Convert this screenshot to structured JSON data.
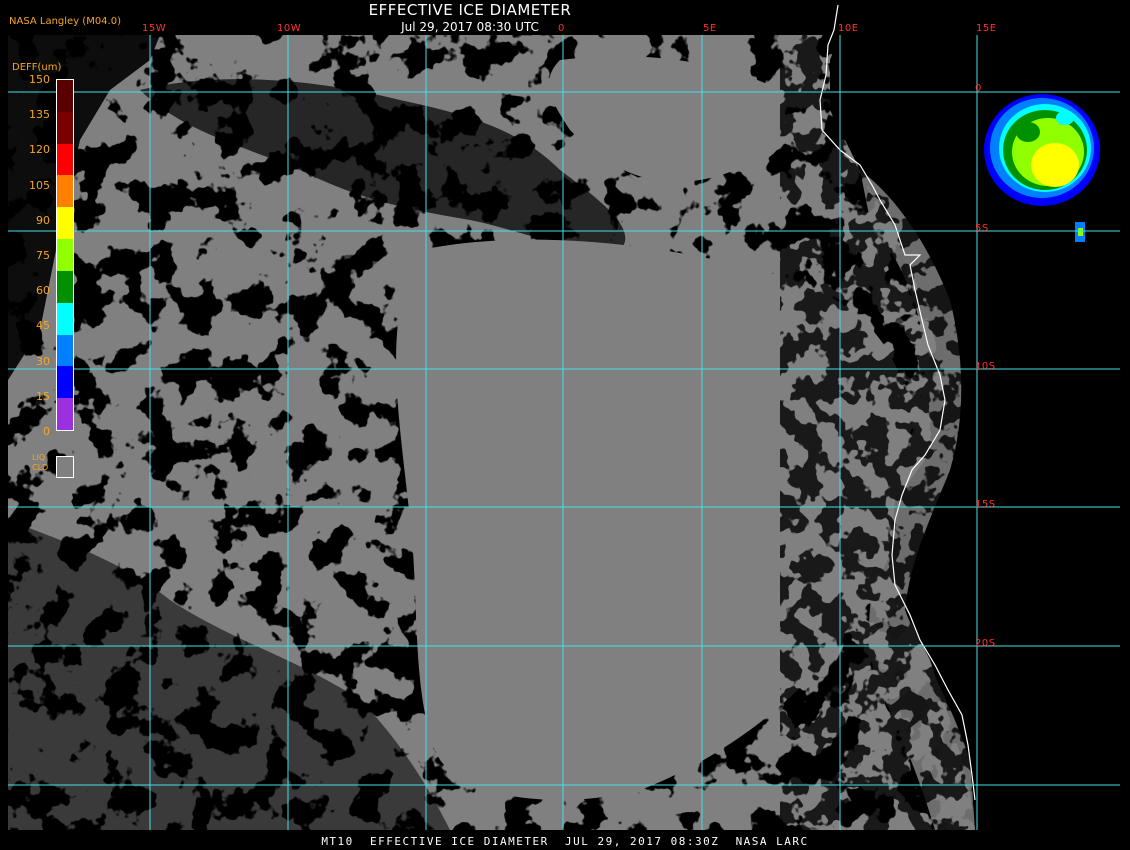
{
  "header": {
    "title": "EFFECTIVE ICE DIAMETER",
    "subtitle": "Jul 29, 2017 08:30 UTC",
    "credit": "NASA Langley (M04.0)"
  },
  "legend": {
    "title": "DEFF(um)",
    "ticks": [
      "150",
      "135",
      "120",
      "105",
      "90",
      "75",
      "60",
      "45",
      "30",
      "15",
      "0"
    ],
    "colors": [
      "#5a0000",
      "#7a0000",
      "#ff0000",
      "#ff7f00",
      "#ffff00",
      "#90ff00",
      "#009000",
      "#00ffff",
      "#0080ff",
      "#0000ff",
      "#9a30e0"
    ],
    "liquid_label": [
      "LIQ",
      "CLD"
    ],
    "liquid_color": "#808080"
  },
  "grid": {
    "longitudes": [
      "15W",
      "10W",
      "0",
      "5E",
      "10E",
      "15E"
    ],
    "latitudes": [
      "0",
      "5S",
      "10S",
      "15S",
      "20S"
    ],
    "line_color": "#40e0e8"
  },
  "colors": {
    "background": "#000000",
    "liquid_cloud": "#808080",
    "coastline": "#ffffff",
    "grid_label": "#ff3030",
    "legend_text": "#f5a623"
  },
  "footer": "MT10  EFFECTIVE ICE DIAMETER  JUL 29, 2017 08:30Z  NASA LARC"
}
